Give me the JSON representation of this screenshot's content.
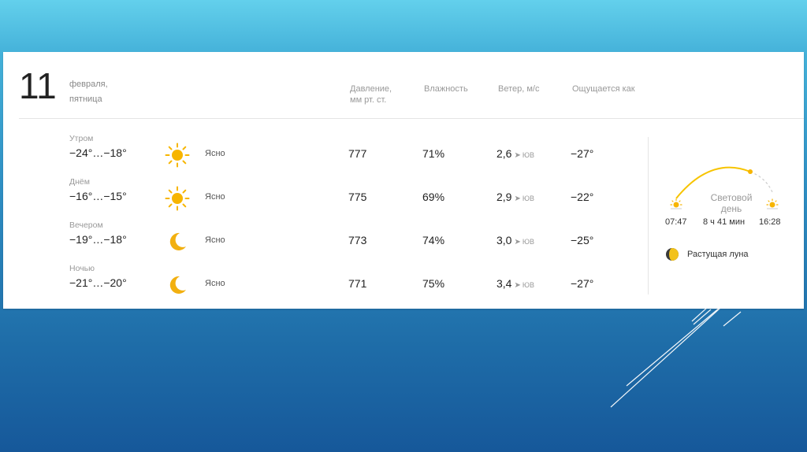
{
  "date": {
    "day": "11",
    "month": "февраля,",
    "weekday": "пятница"
  },
  "columns": {
    "pressure": [
      "Давление,",
      "мм рт. ст."
    ],
    "humidity": "Влажность",
    "wind": "Ветер, м/с",
    "feels": "Ощущается как"
  },
  "rows": [
    {
      "part": "Утром",
      "temp": "−24°…−18°",
      "icon": "sun-icon",
      "cond": "Ясно",
      "pressure": "777",
      "humidity": "71%",
      "wind_speed": "2,6",
      "wind_dir": "ЮВ",
      "feels": "−27°"
    },
    {
      "part": "Днём",
      "temp": "−16°…−15°",
      "icon": "sun-icon",
      "cond": "Ясно",
      "pressure": "775",
      "humidity": "69%",
      "wind_speed": "2,9",
      "wind_dir": "ЮВ",
      "feels": "−22°"
    },
    {
      "part": "Вечером",
      "temp": "−19°…−18°",
      "icon": "moon-icon",
      "cond": "Ясно",
      "pressure": "773",
      "humidity": "74%",
      "wind_speed": "3,0",
      "wind_dir": "ЮВ",
      "feels": "−25°"
    },
    {
      "part": "Ночью",
      "temp": "−21°…−20°",
      "icon": "moon-icon",
      "cond": "Ясно",
      "pressure": "771",
      "humidity": "75%",
      "wind_speed": "3,4",
      "wind_dir": "ЮВ",
      "feels": "−27°"
    }
  ],
  "sun": {
    "label_line1": "Световой",
    "label_line2": "день",
    "sunrise": "07:47",
    "day_length": "8 ч 41 мин",
    "sunset": "16:28"
  },
  "moon": {
    "phase": "Растущая луна"
  },
  "colors": {
    "sun": "#f7b500",
    "moon": "#f2b010",
    "text": "#222222",
    "muted": "#999999"
  }
}
